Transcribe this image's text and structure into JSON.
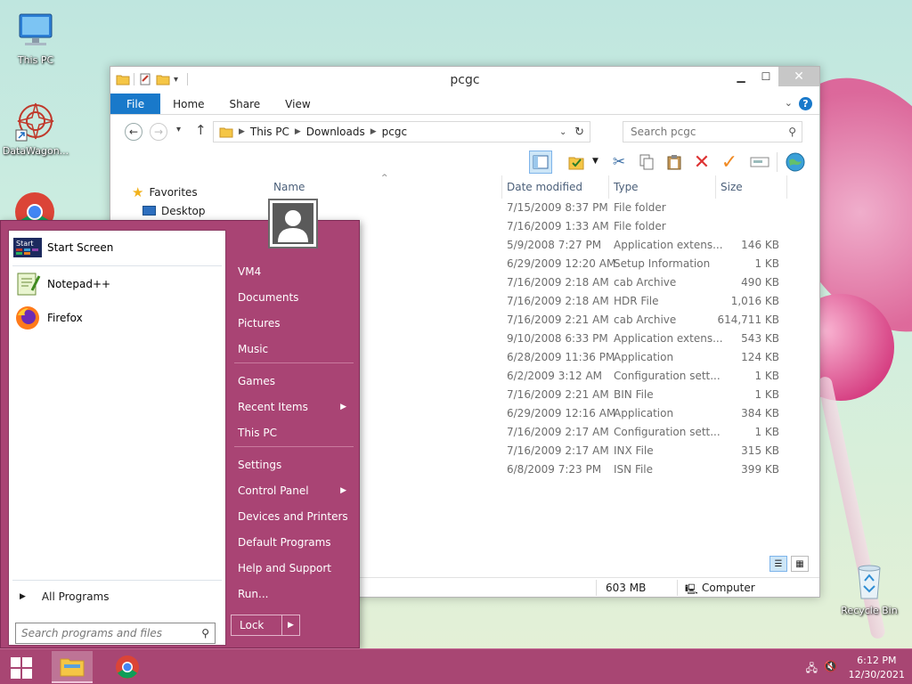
{
  "desktop": {
    "icons": [
      {
        "label": "This PC"
      },
      {
        "label": "DataWagon..."
      },
      {
        "label": "Recycle Bin"
      }
    ]
  },
  "explorer": {
    "title": "pcgc",
    "tabs": [
      "File",
      "Home",
      "Share",
      "View"
    ],
    "breadcrumb": [
      "This PC",
      "Downloads",
      "pcgc"
    ],
    "search_placeholder": "Search pcgc",
    "nav": {
      "favorites": "Favorites",
      "desktop": "Desktop"
    },
    "columns": {
      "name": "Name",
      "date": "Date modified",
      "type": "Type",
      "size": "Size"
    },
    "rows": [
      {
        "name": "",
        "date": "7/15/2009 8:37 PM",
        "type": "File folder",
        "size": ""
      },
      {
        "name": "",
        "date": "7/16/2009 1:33 AM",
        "type": "File folder",
        "size": ""
      },
      {
        "name": "",
        "date": "5/9/2008 7:27 PM",
        "type": "Application extens...",
        "size": "146 KB"
      },
      {
        "name": "",
        "date": "6/29/2009 12:20 AM",
        "type": "Setup Information",
        "size": "1 KB"
      },
      {
        "name": "",
        "date": "7/16/2009 2:18 AM",
        "type": "cab Archive",
        "size": "490 KB"
      },
      {
        "name": "",
        "date": "7/16/2009 2:18 AM",
        "type": "HDR File",
        "size": "1,016 KB"
      },
      {
        "name": "",
        "date": "7/16/2009 2:21 AM",
        "type": "cab Archive",
        "size": "614,711 KB"
      },
      {
        "name": "",
        "date": "9/10/2008 6:33 PM",
        "type": "Application extens...",
        "size": "543 KB"
      },
      {
        "name": "",
        "date": "6/28/2009 11:36 PM",
        "type": "Application",
        "size": "124 KB"
      },
      {
        "name": "",
        "date": "6/2/2009 3:12 AM",
        "type": "Configuration sett...",
        "size": "1 KB"
      },
      {
        "name": "",
        "date": "7/16/2009 2:21 AM",
        "type": "BIN File",
        "size": "1 KB"
      },
      {
        "name": "",
        "date": "6/29/2009 12:16 AM",
        "type": "Application",
        "size": "384 KB"
      },
      {
        "name": "",
        "date": "7/16/2009 2:17 AM",
        "type": "Configuration sett...",
        "size": "1 KB"
      },
      {
        "name": "",
        "date": "7/16/2009 2:17 AM",
        "type": "INX File",
        "size": "315 KB"
      },
      {
        "name": "",
        "date": "6/8/2009 7:23 PM",
        "type": "ISN File",
        "size": "399 KB"
      }
    ],
    "status": {
      "size": "603 MB",
      "location": "Computer"
    }
  },
  "start_menu": {
    "programs": [
      {
        "label": "Start Screen",
        "icon": "start-screen-icon"
      },
      {
        "label": "Notepad++",
        "icon": "notepadpp-icon"
      },
      {
        "label": "Firefox",
        "icon": "firefox-icon"
      }
    ],
    "all_programs": "All Programs",
    "search_placeholder": "Search programs and files",
    "right_links": [
      {
        "label": "VM4"
      },
      {
        "label": "Documents"
      },
      {
        "label": "Pictures"
      },
      {
        "label": "Music"
      },
      {
        "label": "Games"
      },
      {
        "label": "Recent Items"
      },
      {
        "label": "This PC"
      },
      {
        "label": "Settings"
      },
      {
        "label": "Control Panel"
      },
      {
        "label": "Devices and Printers"
      },
      {
        "label": "Default Programs"
      },
      {
        "label": "Help and Support"
      },
      {
        "label": "Run..."
      }
    ],
    "lock_label": "Lock"
  },
  "taskbar": {
    "time": "6:12 PM",
    "date": "12/30/2021"
  },
  "colors": {
    "accent": "#1979ca",
    "start_menu": "#a94474",
    "taskbar": "#a84673"
  }
}
